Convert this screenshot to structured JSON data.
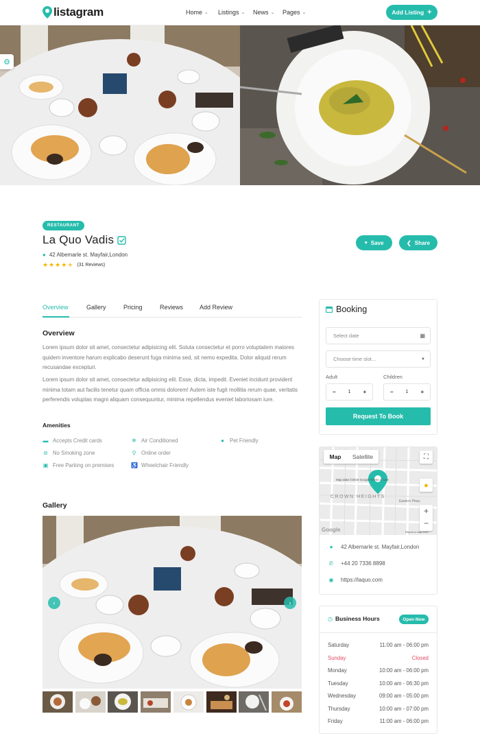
{
  "header": {
    "logo_text": "listagram",
    "nav": [
      {
        "label": "Home"
      },
      {
        "label": "Listings"
      },
      {
        "label": "News"
      },
      {
        "label": "Pages"
      }
    ],
    "add_listing_label": "Add Listing",
    "add_listing_icon": "plus-icon"
  },
  "listing": {
    "category_badge": "RESTAURANT",
    "title": "La Quo Vadis",
    "verified_icon": "check-square-icon",
    "address": "42 Albemarle st. Mayfair,London",
    "rating_value": 4.5,
    "rating_max": 5,
    "reviews_text": "(31 Reviews)",
    "save_label": "Save",
    "share_label": "Share"
  },
  "tabs": [
    {
      "label": "Overview",
      "active": true
    },
    {
      "label": "Gallery",
      "active": false
    },
    {
      "label": "Pricing",
      "active": false
    },
    {
      "label": "Reviews",
      "active": false
    },
    {
      "label": "Add Review",
      "active": false
    }
  ],
  "overview": {
    "heading": "Overview",
    "paragraphs": [
      "Lorem ipsum dolor sit amet, consectetur adipisicing elit. Soluta consectetur et porro voluptatem maiores quidem inventore harum explicabo deserunt fuga minima sed, sit nemo expedita. Dolor aliquid rerum recusandae excepturi.",
      "Lorem ipsum dolor sit amet, consectetur adipisicing elit. Esse, dicta, impedit. Eveniet incidunt provident minima totam aut facilis tenetur quam officia omnis dolorem! Autem iste fugit mollitia rerum quae, veritatis perferendis voluptas magni aliquam consequuntur, minima repellendus eveniet laboriosam iure."
    ]
  },
  "amenities": {
    "heading": "Amenities",
    "items": [
      {
        "label": "Accepts Credit cards",
        "icon": "credit-card-icon"
      },
      {
        "label": "Air Conditioned",
        "icon": "snowflake-icon"
      },
      {
        "label": "Pet Friendly",
        "icon": "paw-icon"
      },
      {
        "label": "No Smoking zone",
        "icon": "no-smoking-icon"
      },
      {
        "label": "Online order",
        "icon": "search-icon"
      },
      {
        "label": "Free Parking on premises",
        "icon": "car-icon"
      },
      {
        "label": "Wheelchair Friendly",
        "icon": "wheelchair-icon"
      }
    ]
  },
  "gallery": {
    "heading": "Gallery",
    "thumbnail_count": 8
  },
  "booking": {
    "heading": "Booking",
    "date_placeholder": "Select date",
    "time_placeholder": "Choose time slot...",
    "adult_label": "Adult",
    "children_label": "Children",
    "adult_value": "1",
    "children_value": "1",
    "minus": "−",
    "plus": "+",
    "button_label": "Request To Book"
  },
  "map": {
    "tab_map": "Map",
    "tab_satellite": "Satellite",
    "area_label": "CROWN HEIGHTS",
    "street_label": "Eastern Pkwy",
    "attribution": "Map data ©2019 Google   Terms of Use",
    "google_logo": "Google",
    "report": "Report a map error",
    "zoom_in": "+",
    "zoom_out": "−"
  },
  "contact": [
    {
      "icon": "map-pin-icon",
      "text": "42 Albemarle st. Mayfair,London"
    },
    {
      "icon": "phone-icon",
      "text": "+44 20 7336 8898"
    },
    {
      "icon": "globe-icon",
      "text": "https://laquo.com"
    }
  ],
  "hours": {
    "heading": "Business Hours",
    "status": "Open Now",
    "rows": [
      {
        "day": "Saturday",
        "time": "11:00 am - 06:00 pm",
        "closed": false
      },
      {
        "day": "Sunday",
        "time": "Closed",
        "closed": true
      },
      {
        "day": "Monday",
        "time": "10:00 am - 06:00 pm",
        "closed": false
      },
      {
        "day": "Tuesday",
        "time": "10:00 am - 06:30 pm",
        "closed": false
      },
      {
        "day": "Wednesday",
        "time": "09:00 am - 05:00 pm",
        "closed": false
      },
      {
        "day": "Thursday",
        "time": "10:00 am - 07:00 pm",
        "closed": false
      },
      {
        "day": "Friday",
        "time": "11:00 am - 06:00 pm",
        "closed": false
      }
    ]
  },
  "colors": {
    "accent": "#26bcac",
    "star": "#f7b500",
    "closed": "#e24c63"
  }
}
